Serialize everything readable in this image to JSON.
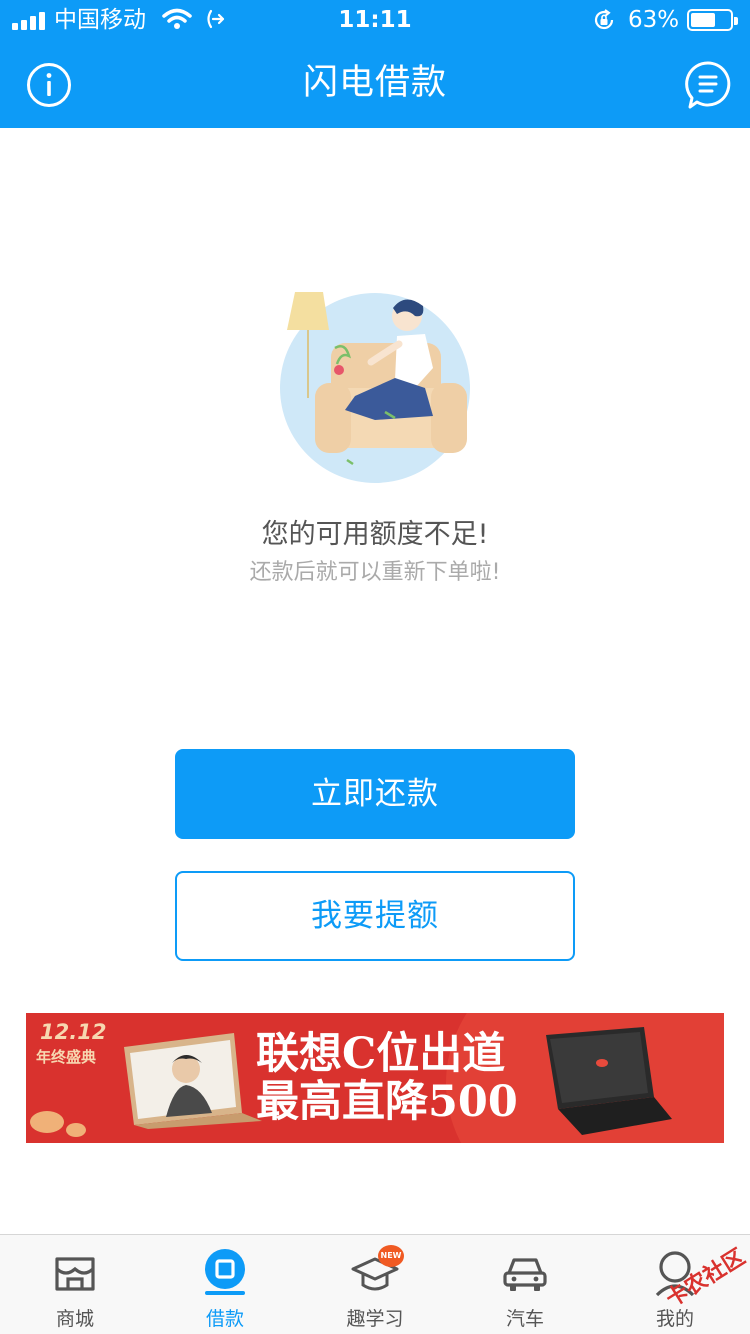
{
  "status_bar": {
    "carrier": "中国移动",
    "time": "11:11",
    "battery_percent": "63%",
    "battery_level": 0.63
  },
  "nav": {
    "title": "闪电借款",
    "left_icon": "info-icon",
    "right_icon": "message-icon"
  },
  "message": {
    "main": "您的可用额度不足!",
    "sub": "还款后就可以重新下单啦!"
  },
  "buttons": {
    "repay": "立即还款",
    "raise_limit": "我要提额"
  },
  "banner": {
    "date": "12.12",
    "tag": "年终盛典",
    "line1": "联想C位出道",
    "line2": "最高直降500"
  },
  "tabbar": {
    "items": [
      {
        "label": "商城",
        "icon": "store-icon",
        "active": false
      },
      {
        "label": "借款",
        "icon": "loan-icon",
        "active": true
      },
      {
        "label": "趣学习",
        "icon": "graduation-cap-icon",
        "active": false,
        "badge": "NEW"
      },
      {
        "label": "汽车",
        "icon": "car-icon",
        "active": false
      },
      {
        "label": "我的",
        "icon": "profile-icon",
        "active": false
      }
    ]
  },
  "watermark": "卡农社区",
  "colors": {
    "primary": "#0d9bf7",
    "banner_red": "#d9322e",
    "text_main": "#555555",
    "text_sub": "#aaaaaa"
  }
}
